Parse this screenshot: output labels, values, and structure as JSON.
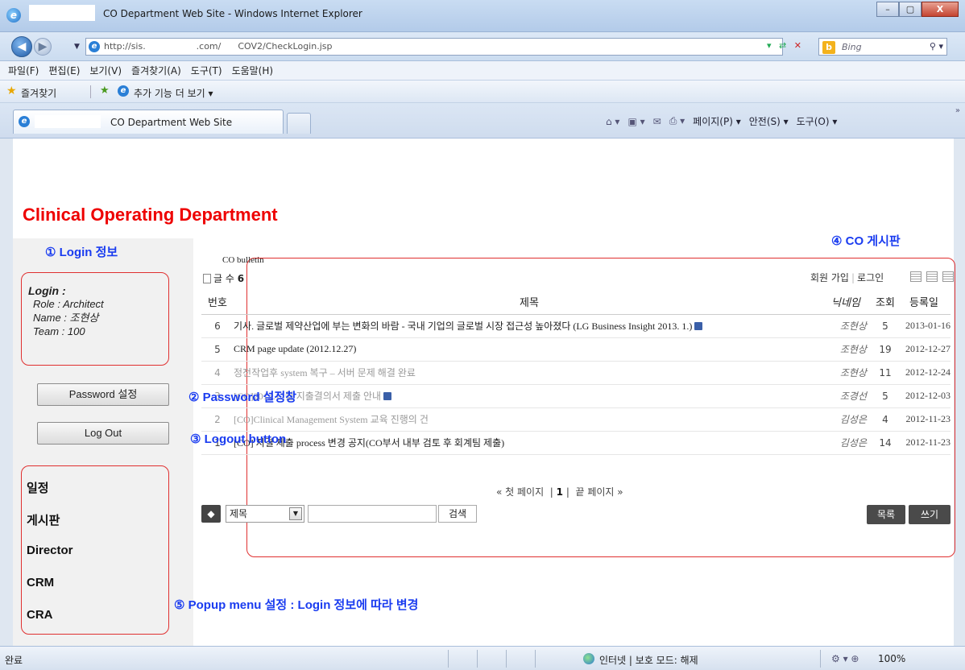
{
  "window": {
    "title": "CO Department Web Site - Windows Internet Explorer",
    "min": "–",
    "max": "▢",
    "close": "X"
  },
  "address": {
    "url": "http://sis.                  .com/      COV2/CheckLogin.jsp",
    "search_placeholder": "Bing"
  },
  "menu": [
    "파일(F)",
    "편집(E)",
    "보기(V)",
    "즐겨찾기(A)",
    "도구(T)",
    "도움말(H)"
  ],
  "favorites": {
    "label": "즐겨찾기",
    "addons": "추가 기능 더 보기 ▾"
  },
  "tab": {
    "label": "CO Department Web Site"
  },
  "commandbar": {
    "page": "페이지(P) ▾",
    "safety": "안전(S) ▾",
    "tools": "도구(O) ▾"
  },
  "page_title": "Clinical Operating Department",
  "annotations": {
    "a1": "① Login 정보",
    "a2": "② Password 설정창",
    "a3": "③ Logout button",
    "a4": "④ CO 게시판",
    "a5": "⑤ Popup menu 설정 : Login 정보에 따라 변경"
  },
  "login": {
    "heading": "Login :",
    "role": "Role : Architect",
    "name": "Name : 조현상",
    "team": "Team : 100"
  },
  "buttons": {
    "password": "Password 설정",
    "logout": "Log Out"
  },
  "side_menu": [
    "일정",
    "게시판",
    "Director",
    "CRM",
    "CRA"
  ],
  "bulletin": {
    "label": "CO bulletin",
    "count_label": "글 수",
    "count": "6",
    "join": "회원 가입",
    "login": "로그인",
    "columns": [
      "번호",
      "제목",
      "닉네임",
      "조회",
      "등록일"
    ],
    "rows": [
      {
        "no": "6",
        "title": "기사. 글로벌 제약산업에 부는 변화의 바람 - 국내 기업의 글로벌 시장 접근성 높아졌다 (LG Business Insight 2013. 1.)",
        "nick": "조현상",
        "views": "5",
        "date": "2013-01-16"
      },
      {
        "no": "5",
        "title": "CRM page update (2012.12.27)",
        "nick": "조현상",
        "views": "19",
        "date": "2012-12-27"
      },
      {
        "no": "4",
        "title": "정전작업후 system 복구 – 서버 문제 해결 완료",
        "nick": "조현상",
        "views": "11",
        "date": "2012-12-24"
      },
      {
        "no": "3",
        "title": "[CO]2012.12월 지출결의서 제출 안내",
        "nick": "조경선",
        "views": "5",
        "date": "2012-12-03"
      },
      {
        "no": "2",
        "title": "[CO]Clinical Management System 교육 진행의 건",
        "nick": "김성은",
        "views": "4",
        "date": "2012-11-23"
      },
      {
        "no": "1",
        "title": "[CO] 지결 제출 process 변경 공지(CO부서 내부 검토 후 회계팀 제출)",
        "nick": "김성은",
        "views": "14",
        "date": "2012-11-23"
      }
    ],
    "pager": {
      "first": "« 첫 페이지",
      "current": "1",
      "last": "끝 페이지 »"
    },
    "search_field": "제목",
    "search_btn": "검색",
    "list_btn": "목록",
    "write_btn": "쓰기"
  },
  "status": {
    "done": "완료",
    "zone": "인터넷 | 보호 모드: 해제",
    "zoom": "100%"
  }
}
